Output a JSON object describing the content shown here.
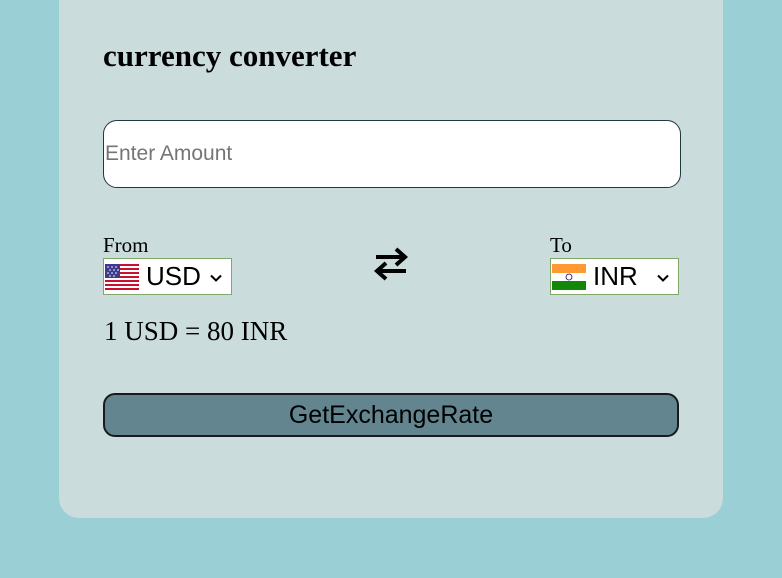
{
  "app": {
    "title": "currency converter"
  },
  "amount_input": {
    "placeholder": "Enter Amount",
    "value": ""
  },
  "from": {
    "label": "From",
    "selected": "USD",
    "flag_icon": "us-flag-icon"
  },
  "to": {
    "label": "To",
    "selected": "INR",
    "flag_icon": "india-flag-icon"
  },
  "swap": {
    "icon": "swap-arrows-icon"
  },
  "rate_text": "1 USD = 80 INR",
  "button": {
    "label": "GetExchangeRate"
  },
  "colors": {
    "page_background": "#9ad0d5",
    "card_background": "#cbdcdc",
    "button_background": "#628590",
    "select_border": "#7fa86a"
  }
}
